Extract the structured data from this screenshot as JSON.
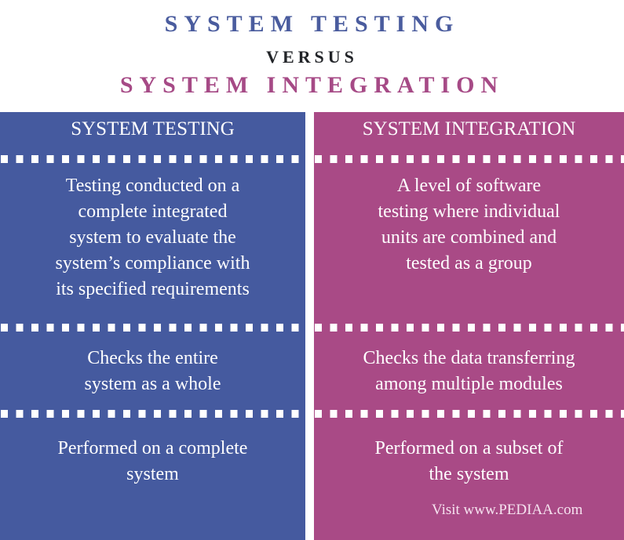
{
  "header": {
    "title_left": "SYSTEM TESTING",
    "versus": "VERSUS",
    "title_right": "SYSTEM INTEGRATION"
  },
  "colors": {
    "left_panel": "#455a9f",
    "right_panel": "#a94a86",
    "title_left": "#4a5c9e",
    "title_right": "#a64a86",
    "versus": "#222428"
  },
  "left": {
    "heading": "SYSTEM TESTING",
    "rows": [
      "Testing conducted on a\ncomplete integrated\nsystem to evaluate the\nsystem’s compliance with\nits specified requirements",
      "Checks the entire\nsystem as a whole",
      "Performed on a complete\nsystem"
    ]
  },
  "right": {
    "heading": "SYSTEM INTEGRATION",
    "rows": [
      "A level of software\ntesting where individual\nunits are combined and\ntested as a group",
      "Checks the data transferring\namong multiple modules",
      "Performed on a subset of\nthe system"
    ],
    "credit": "Visit www.PEDIAA.com"
  }
}
